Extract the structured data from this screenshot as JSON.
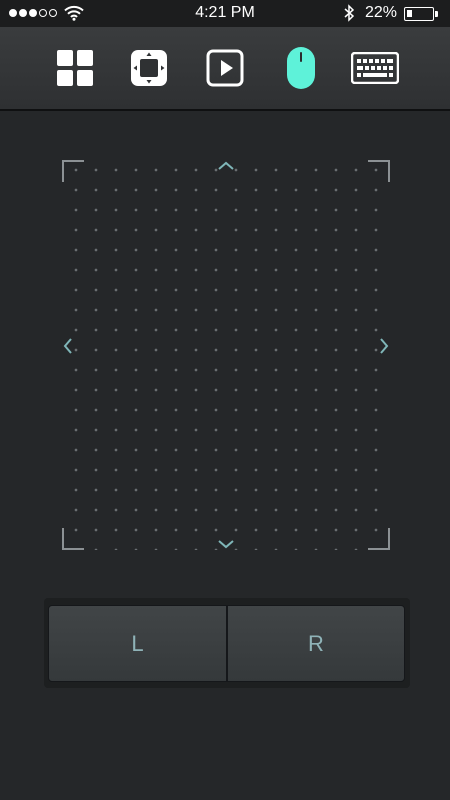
{
  "status_bar": {
    "time": "4:21 PM",
    "battery_percent": "22%",
    "battery_level": 0.22,
    "signal_bars_filled": 3,
    "signal_bars_total": 5,
    "icons": [
      "wifi-icon",
      "bluetooth-icon",
      "battery-icon"
    ]
  },
  "toolbar": {
    "items": [
      {
        "name": "apps-grid",
        "icon": "grid-icon",
        "active": false
      },
      {
        "name": "dpad",
        "icon": "directional-pad-icon",
        "active": false
      },
      {
        "name": "media",
        "icon": "play-icon",
        "active": false
      },
      {
        "name": "mouse",
        "icon": "mouse-icon",
        "active": true
      },
      {
        "name": "keyboard",
        "icon": "keyboard-icon",
        "active": false
      }
    ],
    "active_color": "#5ef2d9",
    "icon_color": "#ffffff"
  },
  "touchpad": {
    "icons": [
      "chevron-up-icon",
      "chevron-down-icon",
      "chevron-left-icon",
      "chevron-right-icon"
    ],
    "accent_color": "#7fb6b8"
  },
  "mouse_buttons": {
    "left_label": "L",
    "right_label": "R"
  }
}
